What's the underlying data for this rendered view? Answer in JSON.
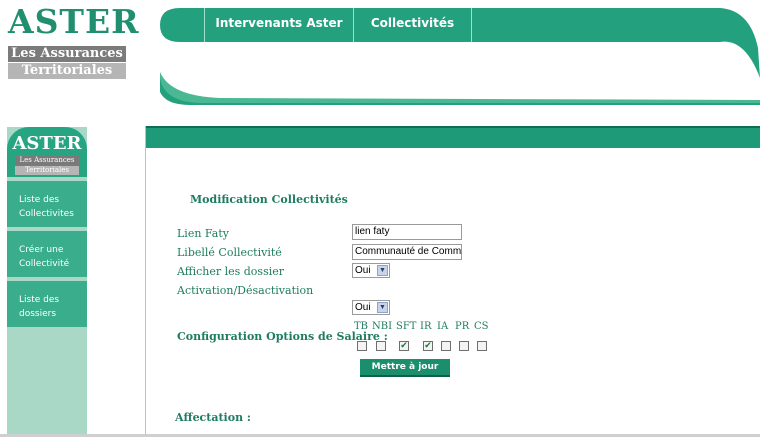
{
  "logo": {
    "brand": "ASTER",
    "line1": "Les Assurances",
    "line2": "Territoriales"
  },
  "topnav": {
    "tabs": [
      {
        "label": "Intervenants Aster"
      },
      {
        "label": "Collectivités"
      }
    ]
  },
  "sidebar": {
    "brand": "ASTER",
    "line1": "Les Assurances",
    "line2": "Territoriales",
    "items": [
      {
        "label_line1": "Liste des",
        "label_line2": "Collectivites"
      },
      {
        "label_line1": "Créer une",
        "label_line2": "Collectivité"
      },
      {
        "label_line1": "Liste des",
        "label_line2": "dossiers"
      }
    ]
  },
  "form": {
    "title": "Modification Collectivités",
    "fields": {
      "lien_faty_label": "Lien Faty",
      "lien_faty_value": "lien faty",
      "libelle_label": "Libellé Collectivité",
      "libelle_value": "Communauté de Comm",
      "afficher_label": "Afficher les dossier",
      "afficher_value": "Oui",
      "activation_label": "Activation/Désactivation",
      "activation_value": "Oui"
    },
    "config_label": "Configuration Options de Salaire :",
    "options": [
      {
        "label": "TB",
        "checked": false
      },
      {
        "label": "NBI",
        "checked": false
      },
      {
        "label": "SFT",
        "checked": true
      },
      {
        "label": "IR",
        "checked": true
      },
      {
        "label": "IA",
        "checked": false
      },
      {
        "label": "PR",
        "checked": false
      },
      {
        "label": "CS",
        "checked": false
      }
    ],
    "update_button": "Mettre à jour",
    "affectation_label": "Affectation :"
  },
  "colors": {
    "brand_green": "#1f8f70",
    "tab_green": "#23a07e",
    "text_green": "#1e7c60",
    "sidebar_light": "#a9d9c6"
  }
}
